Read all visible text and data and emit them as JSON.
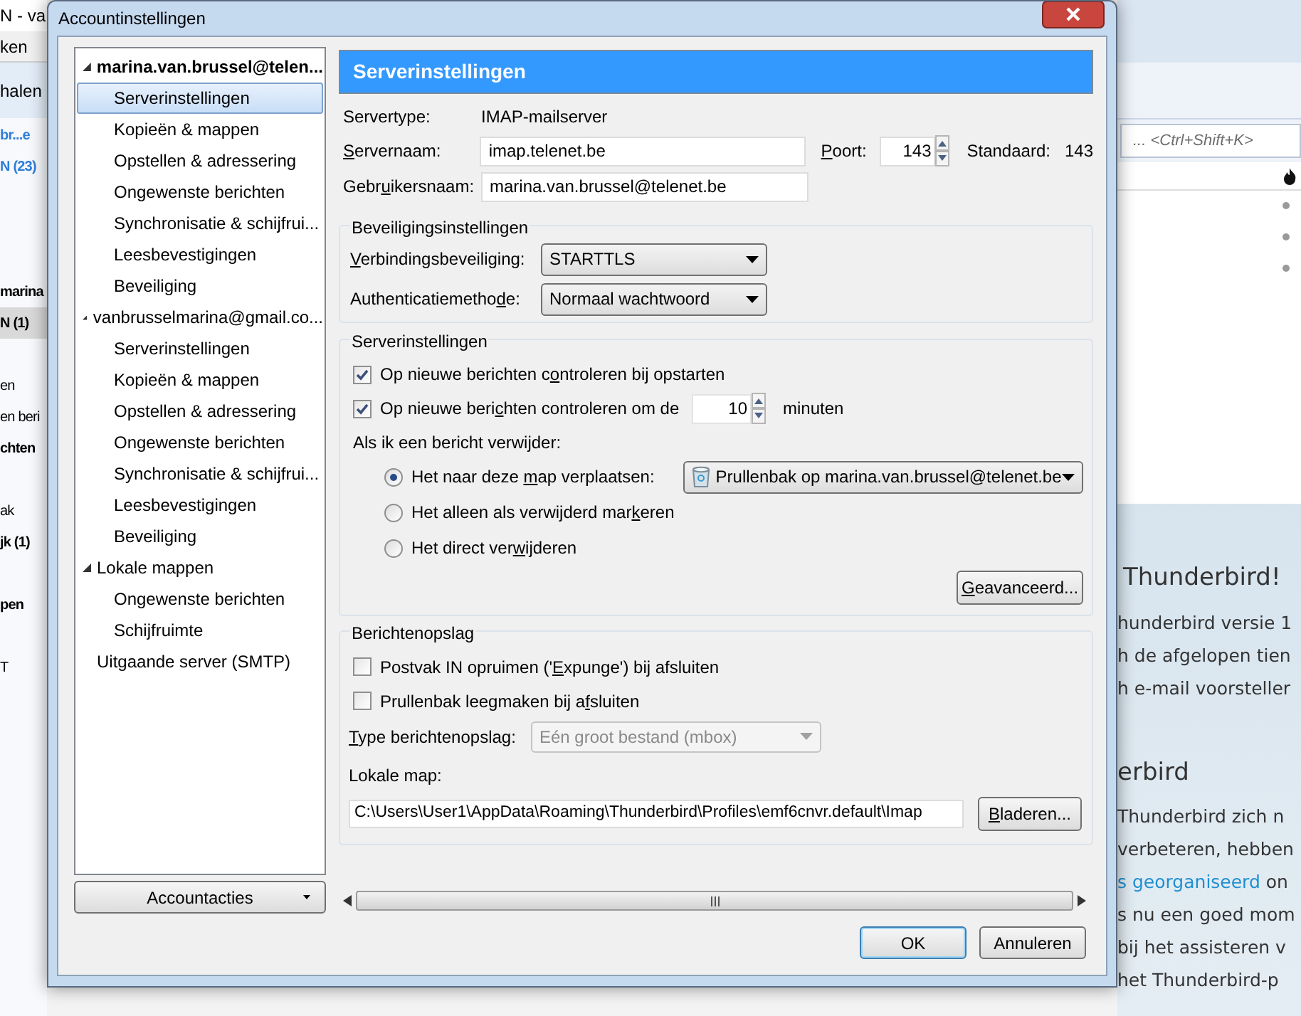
{
  "background": {
    "title": "N - va",
    "menu": "ken",
    "toolbar_button": "halen",
    "folders": [
      {
        "label": "br...e",
        "kind": "account",
        "selected": false
      },
      {
        "label": "N (23)",
        "kind": "account",
        "selected": false
      },
      {
        "kind": "blank"
      },
      {
        "kind": "blank"
      },
      {
        "kind": "blank"
      },
      {
        "label": "marina",
        "kind": "bold",
        "selected": false
      },
      {
        "label": "N (1)",
        "kind": "bold",
        "selected": true
      },
      {
        "kind": "blank"
      },
      {
        "label": "en",
        "kind": "normal",
        "selected": false
      },
      {
        "label": "en beri",
        "kind": "normal",
        "selected": false
      },
      {
        "label": "chten",
        "kind": "bold",
        "selected": false
      },
      {
        "kind": "blank"
      },
      {
        "label": "ak",
        "kind": "normal",
        "selected": false
      },
      {
        "label": "jk (1)",
        "kind": "bold",
        "selected": false
      },
      {
        "kind": "blank"
      },
      {
        "label": "pen",
        "kind": "bold",
        "selected": false
      },
      {
        "kind": "blank"
      },
      {
        "label": "T",
        "kind": "normal",
        "selected": false
      }
    ],
    "search_placeholder": "... <Ctrl+Shift+K>",
    "start_page": {
      "heading": "Thunderbird!",
      "lines": [
        "hunderbird versie 1",
        "h de afgelopen tien",
        "h e-mail voorsteller"
      ],
      "heading2": "erbird",
      "lines2": [
        {
          "text": "Thunderbird zich n"
        },
        {
          "text": "verbeteren, hebben"
        },
        {
          "link": "s georganiseerd",
          "text": " on"
        },
        {
          "text": "s nu een goed mom"
        },
        {
          "text": "bij het assisteren v"
        },
        {
          "text": "het Thunderbird-p"
        }
      ]
    }
  },
  "dialog": {
    "title": "Accountinstellingen",
    "tree": [
      {
        "label": "marina.van.brussel@telen...",
        "expanded": true,
        "children": [
          {
            "label": "Serverinstellingen",
            "selected": true
          },
          {
            "label": "Kopieën & mappen",
            "selected": false
          },
          {
            "label": "Opstellen & adressering",
            "selected": false
          },
          {
            "label": "Ongewenste berichten",
            "selected": false
          },
          {
            "label": "Synchronisatie & schijfrui...",
            "selected": false
          },
          {
            "label": "Leesbevestigingen",
            "selected": false
          },
          {
            "label": "Beveiliging",
            "selected": false
          }
        ]
      },
      {
        "label": "vanbrusselmarina@gmail.co...",
        "expanded": true,
        "children": [
          {
            "label": "Serverinstellingen",
            "selected": false
          },
          {
            "label": "Kopieën & mappen",
            "selected": false
          },
          {
            "label": "Opstellen & adressering",
            "selected": false
          },
          {
            "label": "Ongewenste berichten",
            "selected": false
          },
          {
            "label": "Synchronisatie & schijfrui...",
            "selected": false
          },
          {
            "label": "Leesbevestigingen",
            "selected": false
          },
          {
            "label": "Beveiliging",
            "selected": false
          }
        ]
      },
      {
        "label": "Lokale mappen",
        "expanded": true,
        "children": [
          {
            "label": "Ongewenste berichten",
            "selected": false
          },
          {
            "label": "Schijfruimte",
            "selected": false
          }
        ]
      },
      {
        "label": "Uitgaande server (SMTP)"
      }
    ],
    "account_actions": "Accountacties",
    "panel": {
      "heading": "Serverinstellingen",
      "servertype_label": "Servertype:",
      "servertype": "IMAP-mailserver",
      "servername_label": {
        "key": "S",
        "post": "ervernaam:"
      },
      "servername": "imap.telenet.be",
      "port_label": {
        "key": "P",
        "post": "oort:"
      },
      "port": "143",
      "default_label": "Standaard:",
      "default_port": "143",
      "username_label": {
        "pre": "Gebr",
        "key": "u",
        "post": "ikersnaam:"
      },
      "username": "marina.van.brussel@telenet.be",
      "security": {
        "title": "Beveiligingsinstellingen",
        "connection_label": {
          "key": "V",
          "post": "erbindingsbeveiliging:"
        },
        "connection": "STARTTLS",
        "auth_label": {
          "pre": "Authenticatiemetho",
          "key": "d",
          "post": "e:"
        },
        "auth": "Normaal wachtwoord"
      },
      "server": {
        "title": "Serverinstellingen",
        "check_startup": {
          "label": {
            "pre": "Op nieuwe berichten c",
            "key": "o",
            "post": "ntroleren bij opstarten"
          },
          "checked": true
        },
        "check_interval": {
          "label": {
            "pre": "Op nieuwe beri",
            "key": "c",
            "post": "hten controleren om de"
          },
          "checked": true,
          "value": "10",
          "unit": "minuten"
        },
        "delete_label": "Als ik een bericht verwijder:",
        "delete_options": [
          {
            "label": {
              "pre": "Het naar deze ",
              "key": "m",
              "post": "ap verplaatsen:"
            },
            "selected": true,
            "folder": "Prullenbak op marina.van.brussel@telenet.be"
          },
          {
            "label": {
              "pre": "Het alleen als verwijderd mar",
              "key": "k",
              "post": "eren"
            },
            "selected": false
          },
          {
            "label": {
              "pre": "Het direct ver",
              "key": "w",
              "post": "ijderen"
            },
            "selected": false
          }
        ],
        "advanced": {
          "key": "G",
          "post": "eavanceerd..."
        }
      },
      "storage": {
        "title": "Berichtenopslag",
        "checks": [
          {
            "label": {
              "pre": "Postvak IN opruimen ('",
              "key": "E",
              "post": "xpunge') bij afsluiten"
            },
            "checked": false
          },
          {
            "label": {
              "pre": "Prullenbak leegmaken bij a",
              "key": "f",
              "post": "sluiten"
            },
            "checked": false
          }
        ],
        "type_label": {
          "key": "T",
          "post": "ype berichtenopslag:"
        },
        "type": "Eén groot bestand (mbox)",
        "type_disabled": true,
        "local_label": "Lokale map:",
        "local_path": "C:\\Users\\User1\\AppData\\Roaming\\Thunderbird\\Profiles\\emf6cnvr.default\\Imap",
        "browse": {
          "key": "B",
          "post": "laderen..."
        }
      }
    },
    "buttons": [
      {
        "label": "OK",
        "default": true
      },
      {
        "label": "Annuleren",
        "default": false
      }
    ]
  }
}
